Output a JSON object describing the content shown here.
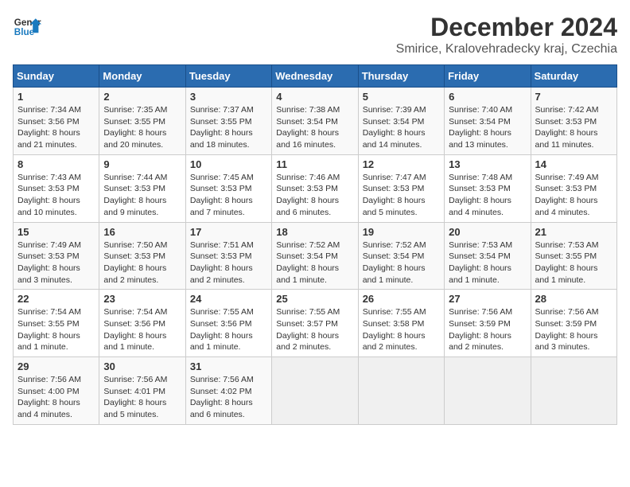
{
  "header": {
    "logo_line1": "General",
    "logo_line2": "Blue",
    "title": "December 2024",
    "subtitle": "Smirice, Kralovehradecky kraj, Czechia"
  },
  "weekdays": [
    "Sunday",
    "Monday",
    "Tuesday",
    "Wednesday",
    "Thursday",
    "Friday",
    "Saturday"
  ],
  "weeks": [
    [
      {
        "day": "1",
        "info": "Sunrise: 7:34 AM\nSunset: 3:56 PM\nDaylight: 8 hours and 21 minutes."
      },
      {
        "day": "2",
        "info": "Sunrise: 7:35 AM\nSunset: 3:55 PM\nDaylight: 8 hours and 20 minutes."
      },
      {
        "day": "3",
        "info": "Sunrise: 7:37 AM\nSunset: 3:55 PM\nDaylight: 8 hours and 18 minutes."
      },
      {
        "day": "4",
        "info": "Sunrise: 7:38 AM\nSunset: 3:54 PM\nDaylight: 8 hours and 16 minutes."
      },
      {
        "day": "5",
        "info": "Sunrise: 7:39 AM\nSunset: 3:54 PM\nDaylight: 8 hours and 14 minutes."
      },
      {
        "day": "6",
        "info": "Sunrise: 7:40 AM\nSunset: 3:54 PM\nDaylight: 8 hours and 13 minutes."
      },
      {
        "day": "7",
        "info": "Sunrise: 7:42 AM\nSunset: 3:53 PM\nDaylight: 8 hours and 11 minutes."
      }
    ],
    [
      {
        "day": "8",
        "info": "Sunrise: 7:43 AM\nSunset: 3:53 PM\nDaylight: 8 hours and 10 minutes."
      },
      {
        "day": "9",
        "info": "Sunrise: 7:44 AM\nSunset: 3:53 PM\nDaylight: 8 hours and 9 minutes."
      },
      {
        "day": "10",
        "info": "Sunrise: 7:45 AM\nSunset: 3:53 PM\nDaylight: 8 hours and 7 minutes."
      },
      {
        "day": "11",
        "info": "Sunrise: 7:46 AM\nSunset: 3:53 PM\nDaylight: 8 hours and 6 minutes."
      },
      {
        "day": "12",
        "info": "Sunrise: 7:47 AM\nSunset: 3:53 PM\nDaylight: 8 hours and 5 minutes."
      },
      {
        "day": "13",
        "info": "Sunrise: 7:48 AM\nSunset: 3:53 PM\nDaylight: 8 hours and 4 minutes."
      },
      {
        "day": "14",
        "info": "Sunrise: 7:49 AM\nSunset: 3:53 PM\nDaylight: 8 hours and 4 minutes."
      }
    ],
    [
      {
        "day": "15",
        "info": "Sunrise: 7:49 AM\nSunset: 3:53 PM\nDaylight: 8 hours and 3 minutes."
      },
      {
        "day": "16",
        "info": "Sunrise: 7:50 AM\nSunset: 3:53 PM\nDaylight: 8 hours and 2 minutes."
      },
      {
        "day": "17",
        "info": "Sunrise: 7:51 AM\nSunset: 3:53 PM\nDaylight: 8 hours and 2 minutes."
      },
      {
        "day": "18",
        "info": "Sunrise: 7:52 AM\nSunset: 3:54 PM\nDaylight: 8 hours and 1 minute."
      },
      {
        "day": "19",
        "info": "Sunrise: 7:52 AM\nSunset: 3:54 PM\nDaylight: 8 hours and 1 minute."
      },
      {
        "day": "20",
        "info": "Sunrise: 7:53 AM\nSunset: 3:54 PM\nDaylight: 8 hours and 1 minute."
      },
      {
        "day": "21",
        "info": "Sunrise: 7:53 AM\nSunset: 3:55 PM\nDaylight: 8 hours and 1 minute."
      }
    ],
    [
      {
        "day": "22",
        "info": "Sunrise: 7:54 AM\nSunset: 3:55 PM\nDaylight: 8 hours and 1 minute."
      },
      {
        "day": "23",
        "info": "Sunrise: 7:54 AM\nSunset: 3:56 PM\nDaylight: 8 hours and 1 minute."
      },
      {
        "day": "24",
        "info": "Sunrise: 7:55 AM\nSunset: 3:56 PM\nDaylight: 8 hours and 1 minute."
      },
      {
        "day": "25",
        "info": "Sunrise: 7:55 AM\nSunset: 3:57 PM\nDaylight: 8 hours and 2 minutes."
      },
      {
        "day": "26",
        "info": "Sunrise: 7:55 AM\nSunset: 3:58 PM\nDaylight: 8 hours and 2 minutes."
      },
      {
        "day": "27",
        "info": "Sunrise: 7:56 AM\nSunset: 3:59 PM\nDaylight: 8 hours and 2 minutes."
      },
      {
        "day": "28",
        "info": "Sunrise: 7:56 AM\nSunset: 3:59 PM\nDaylight: 8 hours and 3 minutes."
      }
    ],
    [
      {
        "day": "29",
        "info": "Sunrise: 7:56 AM\nSunset: 4:00 PM\nDaylight: 8 hours and 4 minutes."
      },
      {
        "day": "30",
        "info": "Sunrise: 7:56 AM\nSunset: 4:01 PM\nDaylight: 8 hours and 5 minutes."
      },
      {
        "day": "31",
        "info": "Sunrise: 7:56 AM\nSunset: 4:02 PM\nDaylight: 8 hours and 6 minutes."
      },
      null,
      null,
      null,
      null
    ]
  ]
}
